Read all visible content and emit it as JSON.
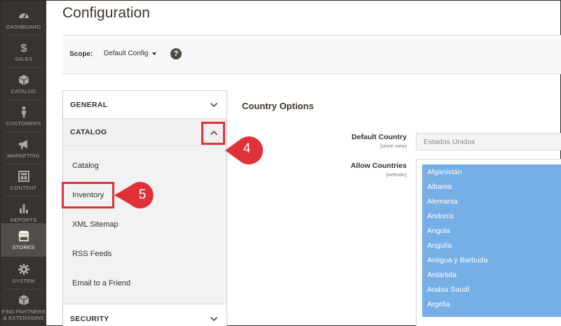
{
  "sidebar": {
    "items": [
      {
        "label": "DASHBOARD",
        "icon": "dashboard-icon"
      },
      {
        "label": "SALES",
        "icon": "dollar-icon"
      },
      {
        "label": "CATALOG",
        "icon": "box-icon"
      },
      {
        "label": "CUSTOMERS",
        "icon": "person-icon"
      },
      {
        "label": "MARKETING",
        "icon": "megaphone-icon"
      },
      {
        "label": "CONTENT",
        "icon": "layout-icon"
      },
      {
        "label": "REPORTS",
        "icon": "bar-chart-icon"
      },
      {
        "label": "STORES",
        "icon": "store-icon"
      },
      {
        "label": "SYSTEM",
        "icon": "gear-icon"
      },
      {
        "label_line1": "FIND PARTNERS",
        "label_line2": "& EXTENSIONS",
        "icon": "cube-icon"
      }
    ],
    "active": "STORES"
  },
  "page": {
    "title": "Configuration"
  },
  "scope": {
    "label": "Scope:",
    "value": "Default Config",
    "help": "?"
  },
  "config_nav": {
    "general": "GENERAL",
    "catalog": "CATALOG",
    "catalog_items": [
      "Catalog",
      "Inventory",
      "XML Sitemap",
      "RSS Feeds",
      "Email to a Friend"
    ],
    "security": "SECURITY"
  },
  "content": {
    "section_title": "Country Options",
    "default_country": {
      "label": "Default Country",
      "scope": "[store view]",
      "value": "Estados Unidos"
    },
    "allow_countries": {
      "label": "Allow Countries",
      "scope": "[website]",
      "options": [
        "Afganistán",
        "Albania",
        "Alemania",
        "Andorra",
        "Angola",
        "Anguila",
        "Antigua y Barbuda",
        "Antártida",
        "Arabia Saudí",
        "Argelia"
      ]
    }
  },
  "callouts": {
    "step4": "4",
    "step5": "5",
    "color": "#e0313b"
  },
  "colors": {
    "sidebar": "#373330",
    "sidebar_active": "#524d49",
    "selection": "#76aee6"
  }
}
